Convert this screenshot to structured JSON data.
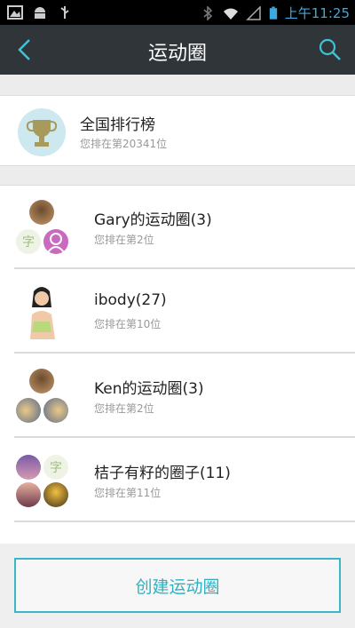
{
  "status_bar": {
    "time": "上午11:25",
    "icons": [
      "image-icon",
      "android-icon",
      "usb-icon",
      "bluetooth-icon",
      "wifi-icon",
      "signal-icon",
      "battery-icon"
    ]
  },
  "header": {
    "title": "运动圈",
    "back_icon": "chevron-left-icon",
    "search_icon": "search-icon"
  },
  "ranking": {
    "name": "全国排行榜",
    "rank_text": "您排在第20341位",
    "icon": "trophy-icon"
  },
  "circles": [
    {
      "name": "Gary的运动圈(3)",
      "rank_text": "您排在第2位"
    },
    {
      "name": "ibody(27)",
      "rank_text": "您排在第10位"
    },
    {
      "name": "Ken的运动圈(3)",
      "rank_text": "您排在第2位"
    },
    {
      "name": "桔子有籽的圈子(11)",
      "rank_text": "您排在第11位"
    }
  ],
  "create_button": {
    "label": "创建运动圈"
  },
  "colors": {
    "accent": "#2fb0c2",
    "header_bg": "#2f3538",
    "status_time": "#3ea9e0"
  }
}
